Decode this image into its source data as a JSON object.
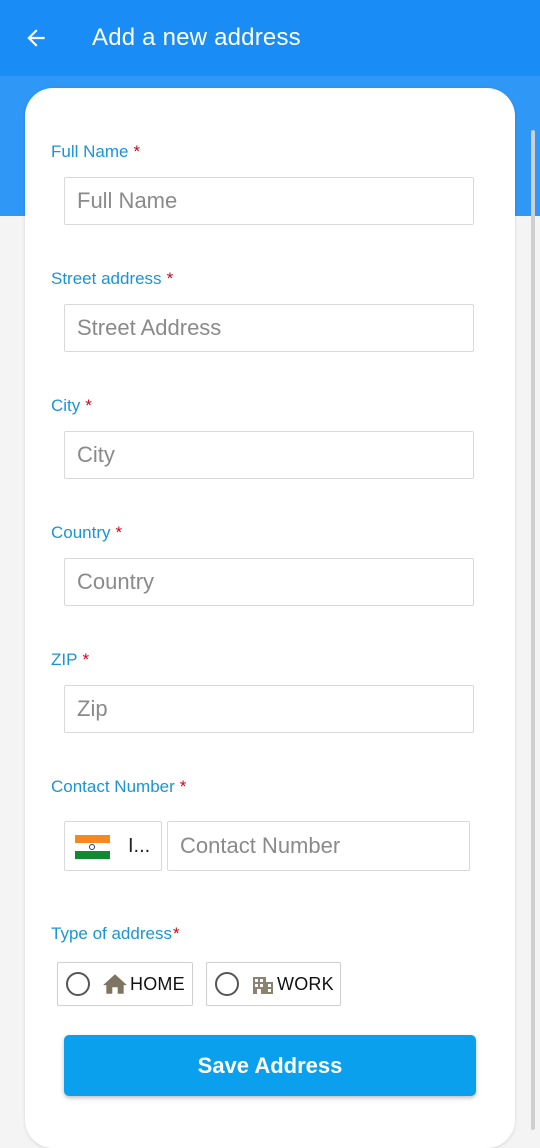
{
  "header": {
    "title": "Add a new address",
    "back_icon": "arrow-left-icon",
    "color": "#1a8cf5"
  },
  "form": {
    "full_name": {
      "label": "Full Name",
      "required_mark": "*",
      "placeholder": "Full Name",
      "value": ""
    },
    "street": {
      "label": "Street address",
      "required_mark": "*",
      "placeholder": "Street Address",
      "value": ""
    },
    "city": {
      "label": "City",
      "required_mark": "*",
      "placeholder": "City",
      "value": ""
    },
    "country": {
      "label": "Country",
      "required_mark": "*",
      "placeholder": "Country",
      "value": ""
    },
    "zip": {
      "label": "ZIP",
      "required_mark": "*",
      "placeholder": "Zip",
      "value": ""
    },
    "contact": {
      "label": "Contact Number",
      "required_mark": "*",
      "country_code_display": "I...",
      "flag_icon": "india-flag-icon",
      "placeholder": "Contact Number",
      "value": ""
    },
    "address_type": {
      "label": "Type of address",
      "required_mark": "*",
      "options": [
        {
          "label": "HOME",
          "icon": "home-icon",
          "selected": false
        },
        {
          "label": "WORK",
          "icon": "building-icon",
          "selected": false
        }
      ]
    },
    "submit_label": "Save Address",
    "label_color": "#1a94d9",
    "required_color": "#d0021b",
    "button_color": "#0aa0ee"
  }
}
